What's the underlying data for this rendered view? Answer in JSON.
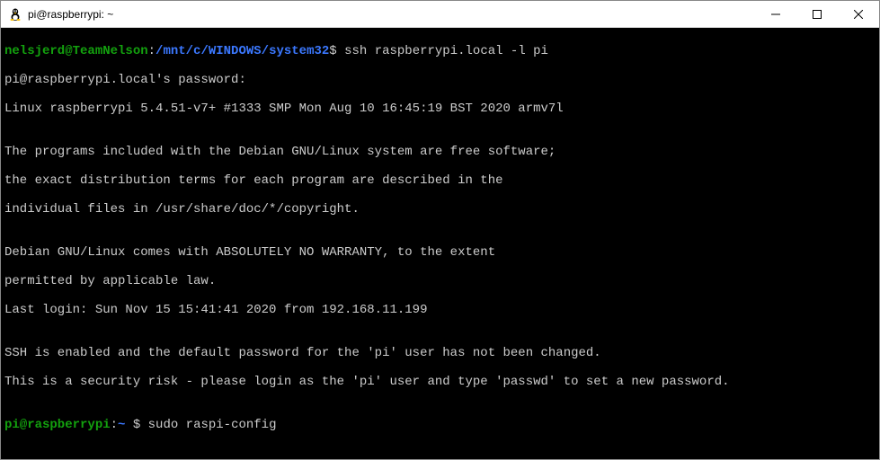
{
  "titlebar": {
    "title": "pi@raspberrypi: ~"
  },
  "terminal": {
    "prompt1_user": "nelsjerd@TeamNelson",
    "prompt1_sep": ":",
    "prompt1_path": "/mnt/c/WINDOWS/system32",
    "prompt1_end": "$ ",
    "prompt1_cmd": "ssh raspberrypi.local -l pi",
    "line2": "pi@raspberrypi.local's password:",
    "line3": "Linux raspberrypi 5.4.51-v7+ #1333 SMP Mon Aug 10 16:45:19 BST 2020 armv7l",
    "line4": "",
    "line5": "The programs included with the Debian GNU/Linux system are free software;",
    "line6": "the exact distribution terms for each program are described in the",
    "line7": "individual files in /usr/share/doc/*/copyright.",
    "line8": "",
    "line9": "Debian GNU/Linux comes with ABSOLUTELY NO WARRANTY, to the extent",
    "line10": "permitted by applicable law.",
    "line11": "Last login: Sun Nov 15 15:41:41 2020 from 192.168.11.199",
    "line12": "",
    "line13": "SSH is enabled and the default password for the 'pi' user has not been changed.",
    "line14": "This is a security risk - please login as the 'pi' user and type 'passwd' to set a new password.",
    "line15": "",
    "prompt2_user": "pi@raspberrypi",
    "prompt2_sep": ":",
    "prompt2_path": "~ ",
    "prompt2_end": "$ ",
    "prompt2_cmd": "sudo raspi-config"
  }
}
